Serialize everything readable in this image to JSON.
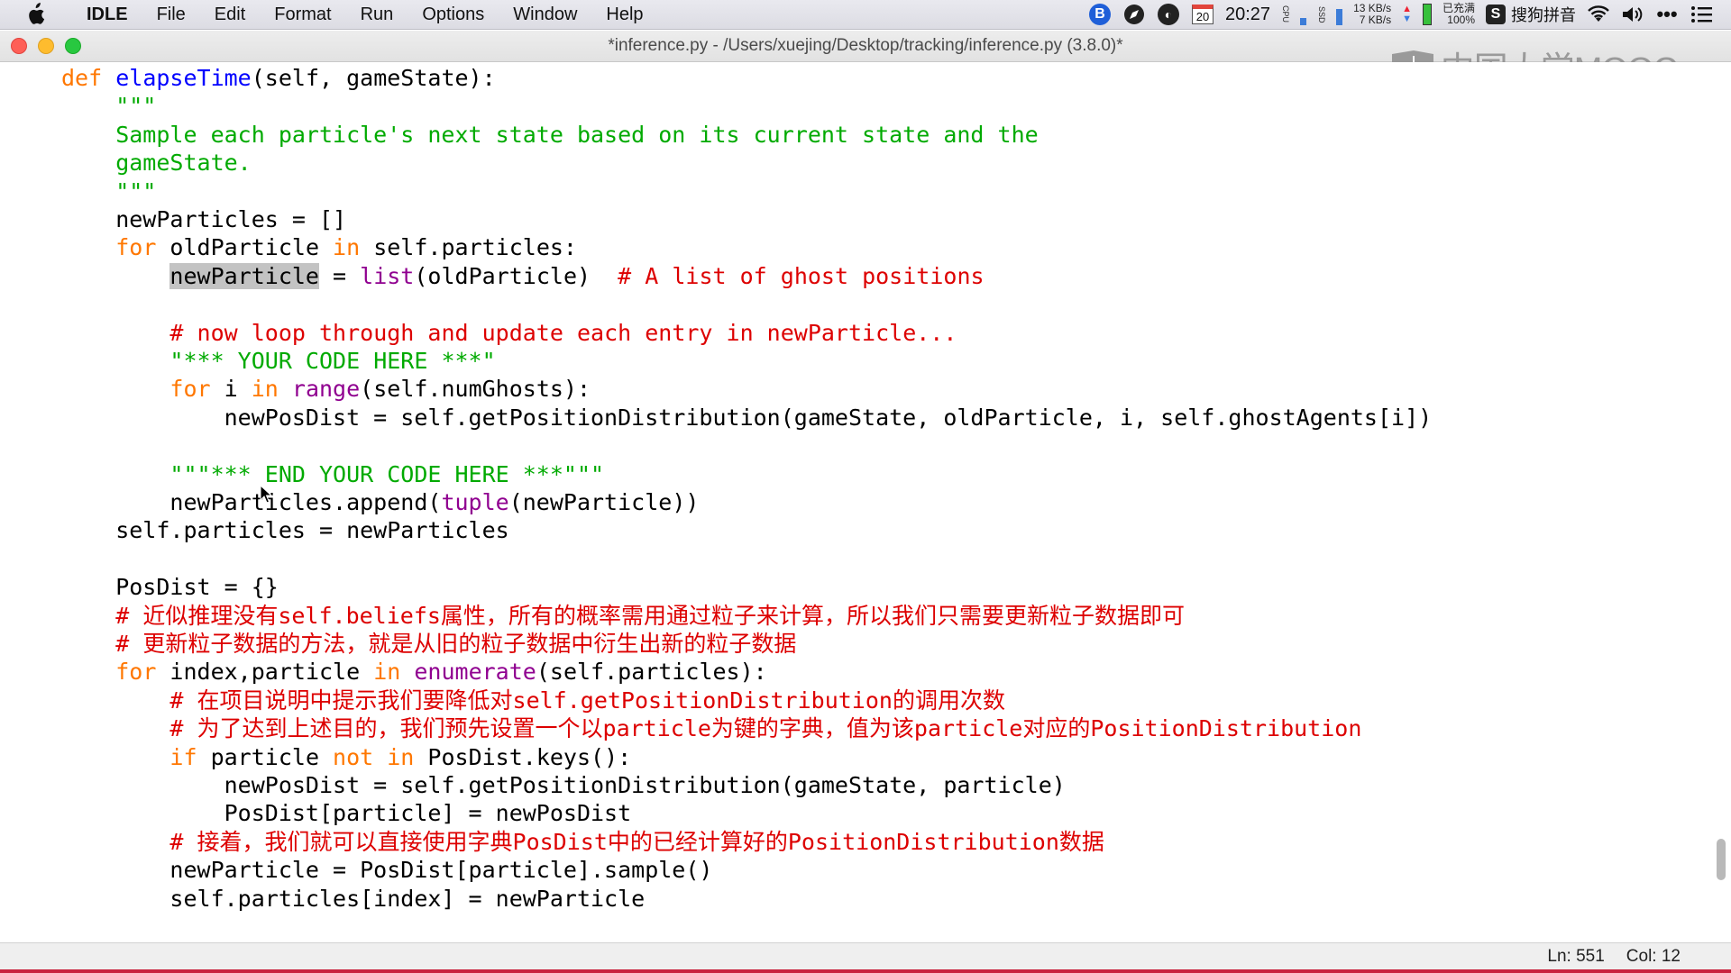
{
  "menubar": {
    "app_name": "IDLE",
    "items": [
      "File",
      "Edit",
      "Format",
      "Run",
      "Options",
      "Window",
      "Help"
    ],
    "tray": {
      "calendar_day": "20",
      "time": "20:27",
      "cpu_label": "CPU",
      "ssd_label": "SSD",
      "net_up": "13 KB/s",
      "net_down": "7 KB/s",
      "battery_status": "已充满",
      "battery_percent": "100%",
      "ime_name": "搜狗拼音",
      "icons": [
        "b-circle-icon",
        "compass-icon",
        "app-dark-icon",
        "wifi-icon",
        "volume-icon",
        "more-icon",
        "list-icon"
      ]
    }
  },
  "window": {
    "title": "*inference.py - /Users/xuejing/Desktop/tracking/inference.py (3.8.0)*"
  },
  "watermark": {
    "text": "中国大学MOOC"
  },
  "code_lines": [
    {
      "tokens": [
        {
          "t": "def ",
          "c": "kw"
        },
        {
          "t": "elapseTime",
          "c": "fn"
        },
        {
          "t": "(self, gameState):",
          "c": ""
        }
      ]
    },
    {
      "tokens": [
        {
          "t": "    \"\"\"",
          "c": "str"
        }
      ]
    },
    {
      "tokens": [
        {
          "t": "    Sample each particle's next state based on its current state and the",
          "c": "str"
        }
      ]
    },
    {
      "tokens": [
        {
          "t": "    gameState.",
          "c": "str"
        }
      ]
    },
    {
      "tokens": [
        {
          "t": "    \"\"\"",
          "c": "str"
        }
      ]
    },
    {
      "tokens": [
        {
          "t": "    newParticles = []",
          "c": ""
        }
      ]
    },
    {
      "tokens": [
        {
          "t": "    ",
          "c": ""
        },
        {
          "t": "for",
          "c": "kw"
        },
        {
          "t": " oldParticle ",
          "c": ""
        },
        {
          "t": "in",
          "c": "kw"
        },
        {
          "t": " self.particles:",
          "c": ""
        }
      ]
    },
    {
      "tokens": [
        {
          "t": "        ",
          "c": ""
        },
        {
          "t": "newParticle",
          "c": "sel"
        },
        {
          "t": " = ",
          "c": ""
        },
        {
          "t": "list",
          "c": "bi"
        },
        {
          "t": "(oldParticle)  ",
          "c": ""
        },
        {
          "t": "# A list of ghost positions",
          "c": "cm"
        }
      ]
    },
    {
      "tokens": [
        {
          "t": "",
          "c": ""
        }
      ]
    },
    {
      "tokens": [
        {
          "t": "        ",
          "c": ""
        },
        {
          "t": "# now loop through and update each entry in newParticle...",
          "c": "cm"
        }
      ]
    },
    {
      "tokens": [
        {
          "t": "        ",
          "c": ""
        },
        {
          "t": "\"*** YOUR CODE HERE ***\"",
          "c": "str"
        }
      ]
    },
    {
      "tokens": [
        {
          "t": "        ",
          "c": ""
        },
        {
          "t": "for",
          "c": "kw"
        },
        {
          "t": " i ",
          "c": ""
        },
        {
          "t": "in",
          "c": "kw"
        },
        {
          "t": " ",
          "c": ""
        },
        {
          "t": "range",
          "c": "bi"
        },
        {
          "t": "(self.numGhosts):",
          "c": ""
        }
      ]
    },
    {
      "tokens": [
        {
          "t": "            newPosDist = self.getPositionDistribution(gameState, oldParticle, i, self.ghostAgents[i])",
          "c": ""
        }
      ]
    },
    {
      "tokens": [
        {
          "t": "",
          "c": ""
        }
      ]
    },
    {
      "tokens": [
        {
          "t": "        ",
          "c": ""
        },
        {
          "t": "\"\"\"*** END YOUR CODE HERE ***\"\"\"",
          "c": "str"
        }
      ]
    },
    {
      "tokens": [
        {
          "t": "        newParticles.append(",
          "c": ""
        },
        {
          "t": "tuple",
          "c": "bi"
        },
        {
          "t": "(newParticle))",
          "c": ""
        }
      ]
    },
    {
      "tokens": [
        {
          "t": "    self.particles = newParticles",
          "c": ""
        }
      ]
    },
    {
      "tokens": [
        {
          "t": "",
          "c": ""
        }
      ]
    },
    {
      "tokens": [
        {
          "t": "    PosDist = {}",
          "c": ""
        }
      ]
    },
    {
      "tokens": [
        {
          "t": "    ",
          "c": ""
        },
        {
          "t": "# 近似推理没有self.beliefs属性，所有的概率需用通过粒子来计算，所以我们只需要更新粒子数据即可",
          "c": "cm"
        }
      ]
    },
    {
      "tokens": [
        {
          "t": "    ",
          "c": ""
        },
        {
          "t": "# 更新粒子数据的方法，就是从旧的粒子数据中衍生出新的粒子数据",
          "c": "cm"
        }
      ]
    },
    {
      "tokens": [
        {
          "t": "    ",
          "c": ""
        },
        {
          "t": "for",
          "c": "kw"
        },
        {
          "t": " index,particle ",
          "c": ""
        },
        {
          "t": "in",
          "c": "kw"
        },
        {
          "t": " ",
          "c": ""
        },
        {
          "t": "enumerate",
          "c": "bi"
        },
        {
          "t": "(self.particles):",
          "c": ""
        }
      ]
    },
    {
      "tokens": [
        {
          "t": "        ",
          "c": ""
        },
        {
          "t": "# 在项目说明中提示我们要降低对self.getPositionDistribution的调用次数",
          "c": "cm"
        }
      ]
    },
    {
      "tokens": [
        {
          "t": "        ",
          "c": ""
        },
        {
          "t": "# 为了达到上述目的，我们预先设置一个以particle为键的字典，值为该particle对应的PositionDistribution",
          "c": "cm"
        }
      ]
    },
    {
      "tokens": [
        {
          "t": "        ",
          "c": ""
        },
        {
          "t": "if",
          "c": "kw"
        },
        {
          "t": " particle ",
          "c": ""
        },
        {
          "t": "not in",
          "c": "kw"
        },
        {
          "t": " PosDist.keys():",
          "c": ""
        }
      ]
    },
    {
      "tokens": [
        {
          "t": "            newPosDist = self.getPositionDistribution(gameState, particle)",
          "c": ""
        }
      ]
    },
    {
      "tokens": [
        {
          "t": "            PosDist[particle] = newPosDist",
          "c": ""
        }
      ]
    },
    {
      "tokens": [
        {
          "t": "        ",
          "c": ""
        },
        {
          "t": "# 接着，我们就可以直接使用字典PosDist中的已经计算好的PositionDistribution数据",
          "c": "cm"
        }
      ]
    },
    {
      "tokens": [
        {
          "t": "        newParticle = PosDist[particle].sample()",
          "c": ""
        }
      ]
    },
    {
      "tokens": [
        {
          "t": "        self.particles[index] = newParticle",
          "c": ""
        }
      ]
    }
  ],
  "statusbar": {
    "line": "Ln: 551",
    "col": "Col: 12"
  },
  "colors": {
    "keyword": "#ff7700",
    "definition": "#0000ff",
    "builtin": "#900090",
    "string": "#00aa00",
    "comment": "#dd0000",
    "selection": "#c3c3c3"
  }
}
